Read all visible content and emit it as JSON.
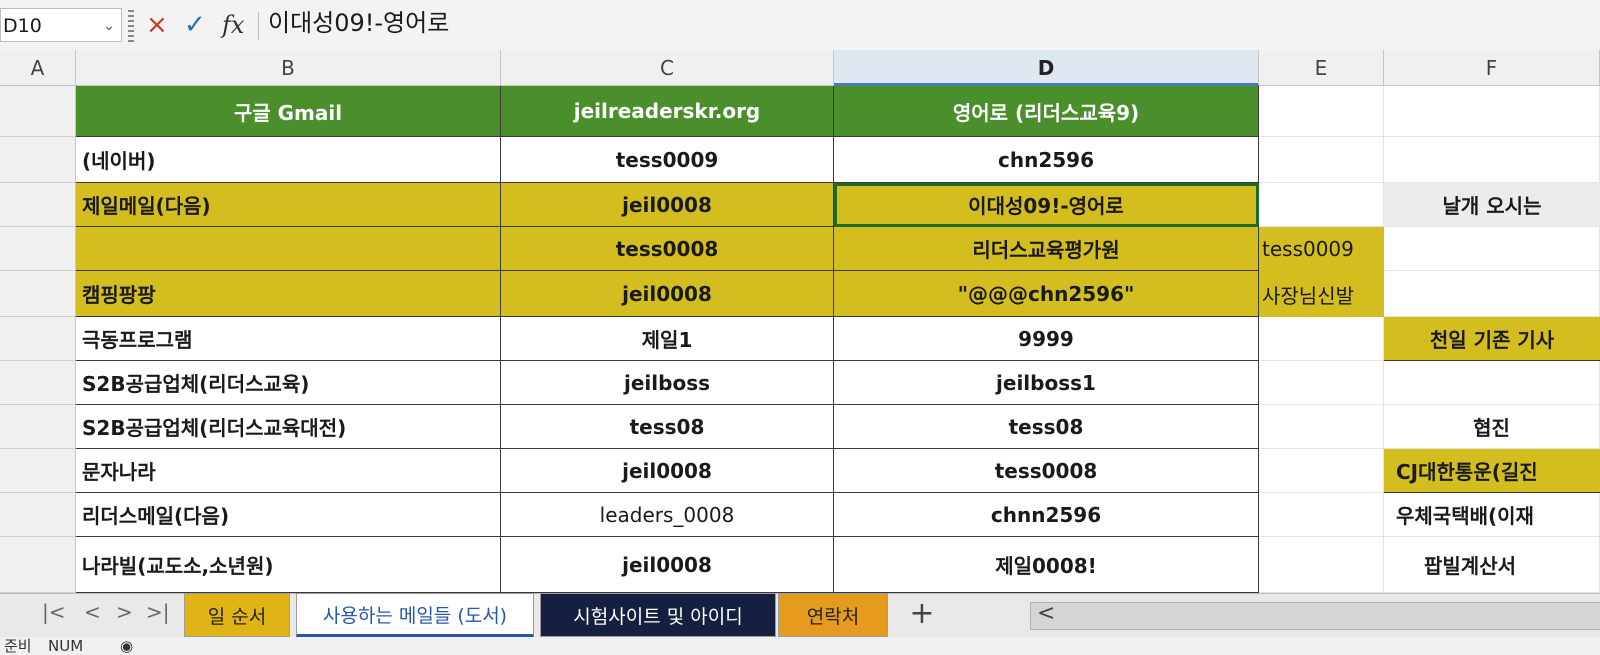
{
  "formula_bar": {
    "name_box": "D10",
    "cancel_icon": "×",
    "confirm_icon": "✓",
    "fx_label": "fx",
    "content": "이대성09!-영어로"
  },
  "columns": [
    "A",
    "B",
    "C",
    "D",
    "E",
    "F"
  ],
  "headers": {
    "b": "구글 Gmail",
    "c": "jeilreaderskr.org",
    "d": "영어로 (리더스교육9)"
  },
  "rows": [
    {
      "b": "(네이버)",
      "c": "tess0009",
      "d": "chn2596",
      "e": "",
      "f": ""
    },
    {
      "b": "제일메일(다음)",
      "c": "jeil0008",
      "d": "이대성09!-영어로",
      "e": "",
      "f": "날개 오시는"
    },
    {
      "b": "",
      "c": "tess0008",
      "d": "리더스교육평가원",
      "e": "tess0009",
      "f": ""
    },
    {
      "b": "캠핑팡팡",
      "c": "jeil0008",
      "d": "\"@@@chn2596\"",
      "e": "사장님신발",
      "f": ""
    },
    {
      "b": "극동프로그램",
      "c": "제일1",
      "d": "9999",
      "e": "",
      "f": "천일 기존 기사"
    },
    {
      "b": "S2B공급업체(리더스교육)",
      "c": "jeilboss",
      "d": "jeilboss1",
      "e": "",
      "f": ""
    },
    {
      "b": "S2B공급업체(리더스교육대전)",
      "c": "tess08",
      "d": "tess08",
      "e": "",
      "f": "협진"
    },
    {
      "b": "문자나라",
      "c": "jeil0008",
      "d": "tess0008",
      "e": "",
      "f": "CJ대한통운(길진"
    },
    {
      "b": "리더스메일(다음)",
      "c": "leaders_0008",
      "d": "chnn2596",
      "e": "",
      "f": "우체국택배(이재"
    },
    {
      "b": "나라빌(교도소,소년원)",
      "c": "jeil0008",
      "d": "제일0008!",
      "e": "",
      "f": "팝빌계산서"
    }
  ],
  "sheet_tabs": [
    "일 순서",
    "사용하는 메일들 (도서)",
    "시험사이트 및 아이디",
    "연락처"
  ],
  "add_sheet": "+",
  "nav_icons": [
    "|<",
    "<",
    ">",
    ">|"
  ],
  "status": {
    "ready": "준비",
    "num": "NUM"
  },
  "colors": {
    "header_green": "#4a8f2c",
    "highlight_yellow": "#d4bd1e",
    "tab_navy": "#152040",
    "tab_orange": "#e59b1e",
    "tab_yellow": "#e0b416"
  }
}
